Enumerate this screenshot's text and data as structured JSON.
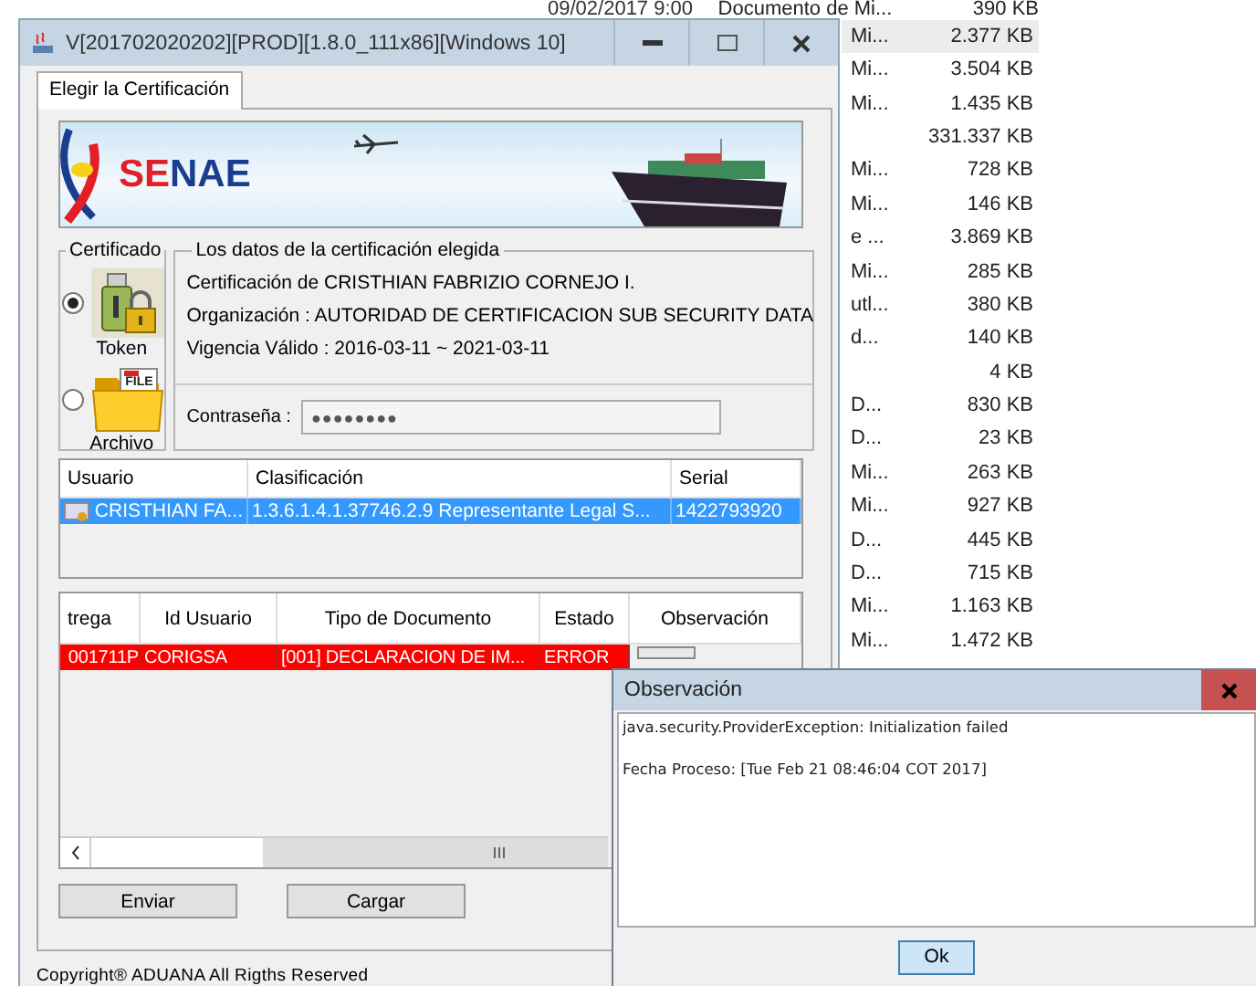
{
  "file_list": {
    "rows": [
      {
        "date": "09/02/2017 9:00",
        "type": "Documento de Mi...",
        "size": "390 KB",
        "selected": false
      },
      {
        "type": "Mi...",
        "size": "2.377 KB",
        "selected": true
      },
      {
        "type": "Mi...",
        "size": "3.504 KB",
        "selected": false
      },
      {
        "type": "Mi...",
        "size": "1.435 KB",
        "selected": false
      },
      {
        "size": "331.337 KB",
        "selected": false
      },
      {
        "type": "Mi...",
        "size": "728 KB",
        "selected": false
      },
      {
        "type": "Mi...",
        "size": "146 KB",
        "selected": false
      },
      {
        "type": "e ...",
        "size": "3.869 KB",
        "selected": false
      },
      {
        "type": "Mi...",
        "size": "285 KB",
        "selected": false
      },
      {
        "type": "utl...",
        "size": "380 KB",
        "selected": false
      },
      {
        "type": "d...",
        "size": "140 KB",
        "selected": false
      },
      {
        "size": "4 KB",
        "selected": false
      },
      {
        "type": "D...",
        "size": "830 KB",
        "selected": false
      },
      {
        "type": "D...",
        "size": "23 KB",
        "selected": false
      },
      {
        "type": "Mi...",
        "size": "263 KB",
        "selected": false
      },
      {
        "type": "Mi...",
        "size": "927 KB",
        "selected": false
      },
      {
        "type": "D...",
        "size": "445 KB",
        "selected": false
      },
      {
        "type": "D...",
        "size": "715 KB",
        "selected": false
      },
      {
        "type": "Mi...",
        "size": "1.163 KB",
        "selected": false
      },
      {
        "type": "Mi...",
        "size": "1.472 KB",
        "selected": false
      }
    ]
  },
  "main_window": {
    "title": "V[201702020202][PROD][1.8.0_111x86][Windows 10]",
    "tabs": [
      {
        "label": "Elegir la Certificación",
        "selected": true
      }
    ],
    "banner": {
      "logo_text": "SENAE"
    },
    "certificate_group": {
      "title": "Certificado",
      "options": [
        {
          "kind": "token",
          "label": "Token",
          "selected": true
        },
        {
          "kind": "file",
          "label": "Archivo",
          "icon_text": "FILE",
          "selected": false
        }
      ]
    },
    "details": {
      "title": "Los datos de la certificación elegida",
      "lines": [
        "Certificación de CRISTHIAN FABRIZIO CORNEJO I.",
        "Organización : AUTORIDAD DE CERTIFICACION SUB SECURITY DATA",
        "Vigencia Válido : 2016-03-11 ~ 2021-03-11"
      ],
      "password": {
        "label": "Contraseña :",
        "value": "●●●●●●●●"
      }
    },
    "certificates_table": {
      "columns": [
        "Usuario",
        "Clasificación",
        "Serial"
      ],
      "rows": [
        {
          "cells": [
            "CRISTHIAN FA...",
            "1.3.6.1.4.1.37746.2.9 Representante Legal S...",
            "1422793920"
          ],
          "selected": true
        }
      ]
    },
    "submissions_table": {
      "columns": [
        "trega",
        "Id Usuario",
        "Tipo de Documento",
        "Estado",
        "Observación"
      ],
      "rows": [
        {
          "cells": [
            "001711P",
            "CORIGSA",
            "[001] DECLARACION DE IM...",
            "ERROR"
          ],
          "error": true
        }
      ]
    },
    "buttons": [
      "Enviar",
      "Cargar"
    ],
    "footer": "Copyright® ADUANA All Rigths Reserved"
  },
  "dialog": {
    "title": "Observación",
    "lines": [
      "java.security.ProviderException: Initialization failed",
      "Fecha Proceso: [Tue Feb 21 08:46:04 COT 2017]"
    ],
    "button": "Ok"
  }
}
